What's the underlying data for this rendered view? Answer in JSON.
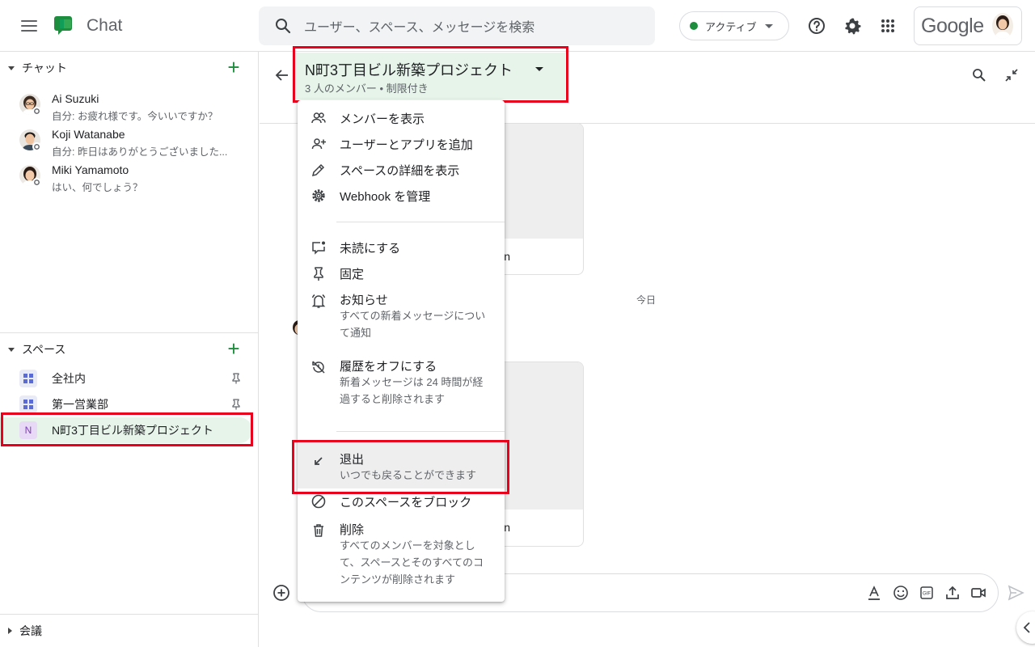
{
  "header": {
    "app_name": "Chat",
    "search_placeholder": "ユーザー、スペース、メッセージを検索",
    "status_label": "アクティブ",
    "google_label": "Google",
    "colors": {
      "chat_green": "#1e8e3e",
      "active_highlight": "#e6f4ea",
      "callout_red": "#e8001c"
    }
  },
  "sidebar": {
    "chat_section": "チャット",
    "dms": [
      {
        "name": "Ai Suzuki",
        "preview": "自分: お疲れ様です。今いいですか？"
      },
      {
        "name": "Koji Watanabe",
        "preview": "自分: 昨日はありがとうございました..."
      },
      {
        "name": "Miki Yamamoto",
        "preview": "はい、何でしょう？"
      }
    ],
    "spaces_section": "スペース",
    "spaces": [
      {
        "name": "全社内",
        "pinned": true
      },
      {
        "name": "第一営業部",
        "pinned": true
      },
      {
        "name": "N町3丁目ビル新築プロジェクト",
        "letter": "N",
        "active": true
      }
    ],
    "meetings_section": "会議"
  },
  "main": {
    "space_title": "N町3丁目ビル新築プロジェクト",
    "space_subtitle": "3 人のメンバー • 制限付き",
    "date_divider": "今日",
    "card_text_1": "n",
    "card_text_2": "n"
  },
  "menu": {
    "items": [
      {
        "label": "メンバーを表示",
        "icon": "people-icon"
      },
      {
        "label": "ユーザーとアプリを追加",
        "icon": "add-person-icon"
      },
      {
        "label": "スペースの詳細を表示",
        "icon": "pencil-icon"
      },
      {
        "label": "Webhook を管理",
        "icon": "gear-icon"
      },
      {
        "label": "未読にする",
        "icon": "mark-unread-icon"
      },
      {
        "label": "固定",
        "icon": "pin-icon"
      },
      {
        "label": "お知らせ",
        "desc": "すべての新着メッセージについて通知",
        "icon": "bell-icon"
      },
      {
        "label": "履歴をオフにする",
        "desc": "新着メッセージは 24 時間が経過すると削除されます",
        "icon": "history-off-icon"
      },
      {
        "label": "退出",
        "desc": "いつでも戻ることができます",
        "icon": "leave-arrow-icon"
      },
      {
        "label": "このスペースをブロック",
        "icon": "block-icon"
      },
      {
        "label": "削除",
        "desc": "すべてのメンバーを対象として、スペースとそのすべてのコンテンツが削除されます",
        "icon": "trash-icon"
      }
    ]
  }
}
